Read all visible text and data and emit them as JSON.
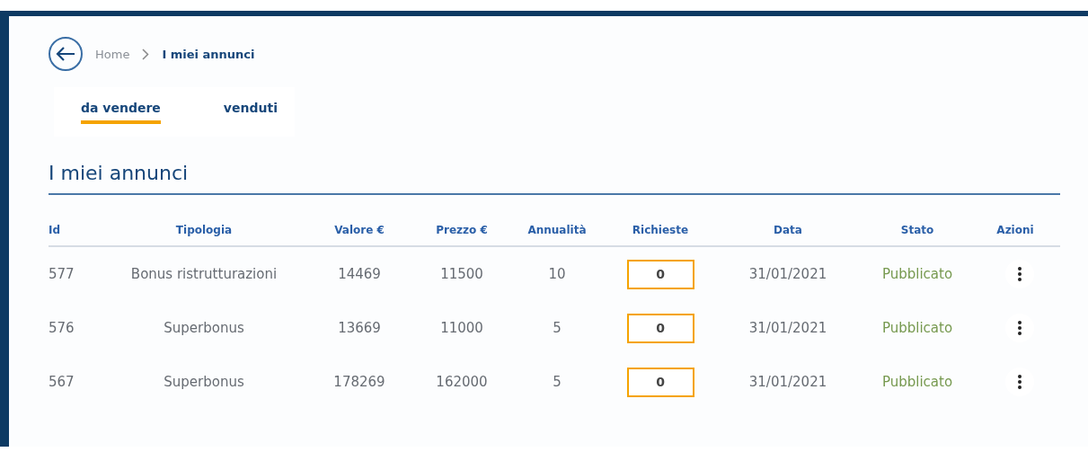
{
  "breadcrumb": {
    "items": [
      "Home",
      "I miei annunci"
    ]
  },
  "tabs": [
    {
      "label": "da vendere",
      "selected": true
    },
    {
      "label": "venduti",
      "selected": false
    }
  ],
  "title": "I miei annunci",
  "table": {
    "columns": [
      "Id",
      "Tipologia",
      "Valore €",
      "Prezzo €",
      "Annualità",
      "Richieste",
      "Data",
      "Stato",
      "Azioni"
    ],
    "rows": [
      {
        "id": "577",
        "tipologia": "Bonus ristrutturazioni",
        "valore": "14469",
        "prezzo": "11500",
        "annualita": "10",
        "richieste": "0",
        "data": "31/01/2021",
        "stato": "Pubblicato"
      },
      {
        "id": "576",
        "tipologia": "Superbonus",
        "valore": "13669",
        "prezzo": "11000",
        "annualita": "5",
        "richieste": "0",
        "data": "31/01/2021",
        "stato": "Pubblicato"
      },
      {
        "id": "567",
        "tipologia": "Superbonus",
        "valore": "178269",
        "prezzo": "162000",
        "annualita": "5",
        "richieste": "0",
        "data": "31/01/2021",
        "stato": "Pubblicato"
      }
    ]
  }
}
